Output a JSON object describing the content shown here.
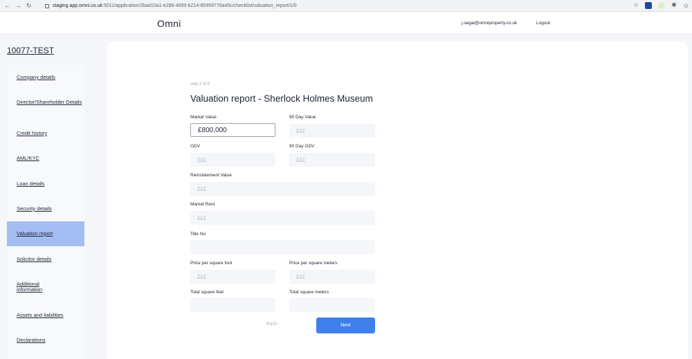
{
  "browser": {
    "url_host": "staging.app.omni.co.uk",
    "url_path": ":5011/application/2bad10a1-e289-4699-b214-85959776a45c/checklist/valuation_report/1/0"
  },
  "header": {
    "logo": "Omni",
    "user_email": "j.segal@omniproperty.co.uk",
    "logout": "Logout"
  },
  "project": {
    "title": "10077-TEST"
  },
  "sidebar": {
    "items": [
      {
        "label": "Company details"
      },
      {
        "label": "Director/Shareholder Details"
      },
      {
        "label": "Credit history"
      },
      {
        "label": "AML/KYC"
      },
      {
        "label": "Loan details"
      },
      {
        "label": "Security details"
      },
      {
        "label": "Valuation report",
        "active": true
      },
      {
        "label": "Solicitor details"
      },
      {
        "label": "Additional information"
      },
      {
        "label": "Assets and liabilities"
      },
      {
        "label": "Declarations"
      }
    ]
  },
  "form": {
    "step": "step 2 of 5",
    "title": "Valuation report - Sherlock Holmes Museum",
    "fields": {
      "market_value": {
        "label": "Market Value",
        "value": "£800,000"
      },
      "day90_value": {
        "label": "90 Day Value",
        "placeholder": "£££"
      },
      "gdv": {
        "label": "GDV",
        "placeholder": "£££"
      },
      "day90_gdv": {
        "label": "90 Day GDV",
        "placeholder": "£££"
      },
      "reinstatement": {
        "label": "Reinstatement Value",
        "placeholder": "£££"
      },
      "market_rent": {
        "label": "Market Rent",
        "placeholder": "£££"
      },
      "title_no": {
        "label": "Title No",
        "placeholder": ""
      },
      "price_sqft": {
        "label": "Price per square foot",
        "placeholder": "£££"
      },
      "price_sqm": {
        "label": "Price per square meters",
        "placeholder": "£££"
      },
      "total_sqft": {
        "label": "Total square feet",
        "placeholder": ""
      },
      "total_sqm": {
        "label": "Total square meters",
        "placeholder": ""
      }
    },
    "back": "Back",
    "next": "Next"
  },
  "colors": {
    "accent": "#3f7fed",
    "active_nav": "#a4bdf3"
  }
}
